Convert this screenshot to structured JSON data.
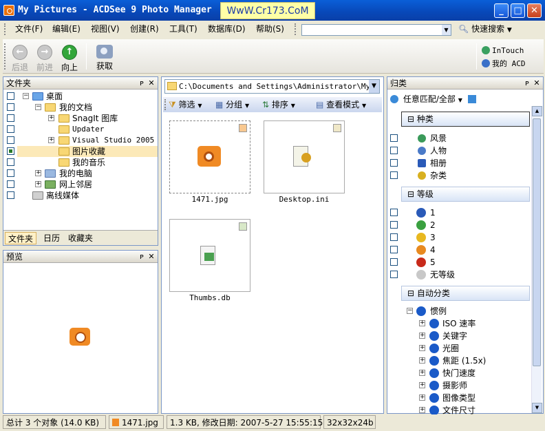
{
  "window": {
    "title": "My Pictures - ACDSee 9 Photo Manager",
    "watermark": "WwW.Cr173.CoM",
    "min": "_",
    "max": "□",
    "close": "✕"
  },
  "menu": {
    "items": [
      "文件(F)",
      "编辑(E)",
      "视图(V)",
      "创建(R)",
      "工具(T)",
      "数据库(D)",
      "帮助(S)"
    ],
    "search_value": "",
    "quick_search": "快速搜索"
  },
  "toolbar": {
    "back": "后退",
    "forward": "前进",
    "up": "向上",
    "acquire": "获取",
    "intouch": "InTouch",
    "my_acd": "我的 ACD"
  },
  "folders_panel": {
    "title": "文件夹",
    "pin": "ᴘ",
    "close": "✕",
    "tree": [
      "桌面",
      "我的文档",
      "SnagIt 图库",
      "Updater",
      "Visual Studio 2005",
      "图片收藏",
      "我的音乐",
      "我的电脑",
      "网上邻居",
      "离线媒体"
    ],
    "tabs": [
      "文件夹",
      "日历",
      "收藏夹"
    ]
  },
  "preview_panel": {
    "title": "预览",
    "pin": "ᴘ",
    "close": "✕"
  },
  "browser": {
    "path": "C:\\Documents and Settings\\Administrator\\My Do",
    "filter": "筛选",
    "group": "分组",
    "sort": "排序",
    "view_mode": "查看模式",
    "files": [
      "1471.jpg",
      "Desktop.ini",
      "Thumbs.db"
    ]
  },
  "catalog_panel": {
    "title": "归类",
    "pin": "ᴘ",
    "close": "✕",
    "match": "任意匹配/全部",
    "section_categories": "种类",
    "categories": [
      "风景",
      "人物",
      "相册",
      "杂类"
    ],
    "section_ratings": "等级",
    "ratings": [
      "1",
      "2",
      "3",
      "4",
      "5",
      "无等级"
    ],
    "section_auto": "自动分类",
    "auto_root": "惯例",
    "auto_items": [
      "ISO 速率",
      "关键字",
      "光圈",
      "焦距 (1.5x)",
      "快门速度",
      "摄影师",
      "图像类型",
      "文件尺寸"
    ]
  },
  "status": {
    "total": "总计 3 个对象 (14.0 KB)",
    "file": "1471.jpg",
    "info": "1.3 KB, 修改日期: 2007-5-27 15:55:15",
    "dims": "32x32x24b"
  },
  "colors": {
    "titlebar": "#0a4fc8",
    "panel_border": "#7a96c8",
    "selection": "#fce9b8",
    "up_arrow": "#33a63a",
    "camera": "#f08a24"
  }
}
